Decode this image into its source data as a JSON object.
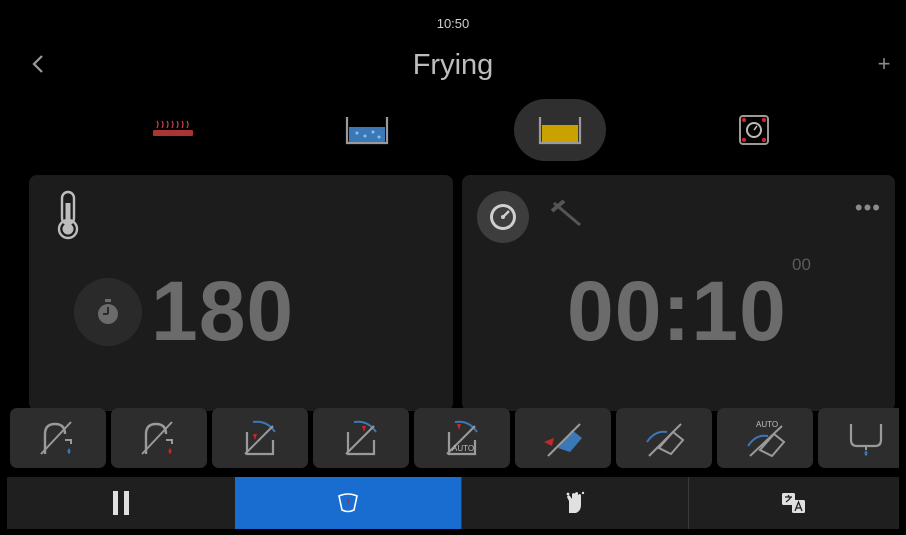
{
  "status_bar": {
    "time": "10:50"
  },
  "header": {
    "title": "Frying",
    "back_icon": "chevron-left-icon",
    "add_symbol": "+"
  },
  "modes": [
    {
      "id": "grill",
      "icon": "grill-icon",
      "active": false
    },
    {
      "id": "boiling",
      "icon": "water-bath-icon",
      "active": false
    },
    {
      "id": "frying",
      "icon": "oil-bath-icon",
      "active": true
    },
    {
      "id": "pressure",
      "icon": "pressure-cooking-icon",
      "active": false
    }
  ],
  "temperature_panel": {
    "value": "180"
  },
  "time_panel": {
    "value": "00:10",
    "seconds": "00",
    "more_symbol": "•••"
  },
  "function_buttons": [
    {
      "icon": "add-water-icon"
    },
    {
      "icon": "add-heat-icon"
    },
    {
      "icon": "tilt-manual-icon"
    },
    {
      "icon": "tilt-heat-icon"
    },
    {
      "icon": "tilt-auto-icon",
      "label": "AUTO"
    },
    {
      "icon": "tilt-pour-icon"
    },
    {
      "icon": "tilt-pan-icon"
    },
    {
      "icon": "tilt-auto-pan-icon",
      "label": "AUTO"
    },
    {
      "icon": "drain-icon"
    }
  ],
  "bottom_nav": [
    {
      "icon": "pause-icon",
      "active": false
    },
    {
      "icon": "tilt-gauge-icon",
      "active": true
    },
    {
      "icon": "hand-wash-icon",
      "active": false
    },
    {
      "icon": "translate-icon",
      "active": false
    }
  ],
  "colors": {
    "accent": "#1a6dd0",
    "oil": "#c9a200",
    "water": "#3a78b8",
    "heat": "#c62828"
  }
}
